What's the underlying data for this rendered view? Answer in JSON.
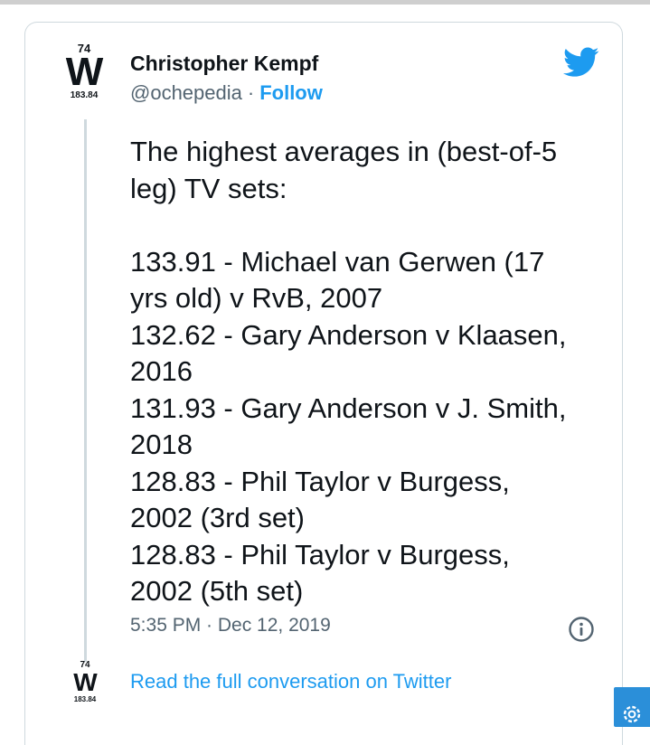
{
  "author": {
    "name": "Christopher Kempf",
    "handle": "@ochepedia",
    "separator": "·",
    "follow_label": "Follow",
    "avatar": {
      "number": "74",
      "symbol": "W",
      "mass": "183.84"
    }
  },
  "tweet": {
    "intro_lines": [
      "The highest averages in (best-of-5",
      "leg) TV sets:"
    ],
    "list_lines": [
      "133.91 - Michael van Gerwen (17",
      "yrs old) v RvB, 2007",
      "132.62 - Gary Anderson v Klaasen,",
      "2016",
      "131.93 - Gary Anderson v J. Smith,",
      "2018",
      "128.83 - Phil Taylor v Burgess,",
      "2002 (3rd set)",
      "128.83 - Phil Taylor v Burgess,",
      "2002 (5th set)"
    ],
    "timestamp": "5:35 PM · Dec 12, 2019"
  },
  "footer": {
    "read_more": "Read the full conversation on Twitter",
    "avatar": {
      "number": "74",
      "symbol": "W",
      "mass": "183.84"
    }
  },
  "icons": {
    "brand": "twitter-bird-icon",
    "info": "info-icon",
    "settings": "gear-icon"
  },
  "colors": {
    "accent": "#1d9bf0",
    "text": "#0f1419",
    "secondary": "#536471",
    "border": "#cfd9de",
    "fab": "#2b8fd9"
  }
}
